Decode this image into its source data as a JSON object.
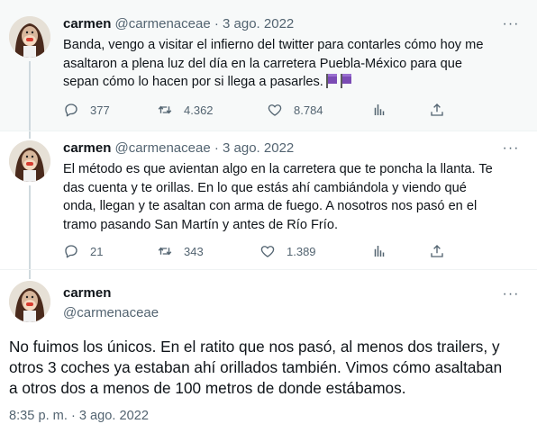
{
  "tweets": [
    {
      "name": "carmen",
      "handle": "@carmenaceae",
      "dot": "·",
      "date": "3 ago. 2022",
      "lines": [
        "Banda, vengo a visitar el infierno del twitter para contarles cómo hoy me",
        "asaltaron a plena luz del día en la carretera Puebla-México para que",
        "sepan cómo lo hacen por si llega a pasarles."
      ],
      "emoji": "flag-emoji x2",
      "replies": "377",
      "retweets": "4.362",
      "likes": "8.784"
    },
    {
      "name": "carmen",
      "handle": "@carmenaceae",
      "dot": "·",
      "date": "3 ago. 2022",
      "lines": [
        "El método es que avientan algo en la carretera que te poncha la llanta. Te",
        "das cuenta y te orillas. En lo que estás ahí cambiándola y viendo qué",
        "onda, llegan y te asaltan con arma de fuego. A nosotros nos pasó en el",
        "tramo pasando San Martín y antes de Río Frío."
      ],
      "replies": "21",
      "retweets": "343",
      "likes": "1.389"
    },
    {
      "name": "carmen",
      "handle": "@carmenaceae",
      "lines": [
        "No fuimos los únicos. En el ratito que nos pasó, al menos dos trailers, y",
        "otros 3 coches ya estaban ahí orillados también. Vimos cómo asaltaban",
        "a otros dos a menos de 100 metros de donde estábamos."
      ],
      "timestamp": "8:35 p. m. · 3 ago. 2022"
    }
  ],
  "icons": {
    "more": "more-icon",
    "reply": "reply-icon",
    "retweet": "retweet-icon",
    "like": "heart-icon",
    "views": "analytics-icon",
    "share": "share-icon"
  },
  "colors": {
    "text": "#0f1419",
    "secondary": "#536471",
    "thread_line": "#cfd9de",
    "highlight_bg": "#f7f9f9"
  }
}
